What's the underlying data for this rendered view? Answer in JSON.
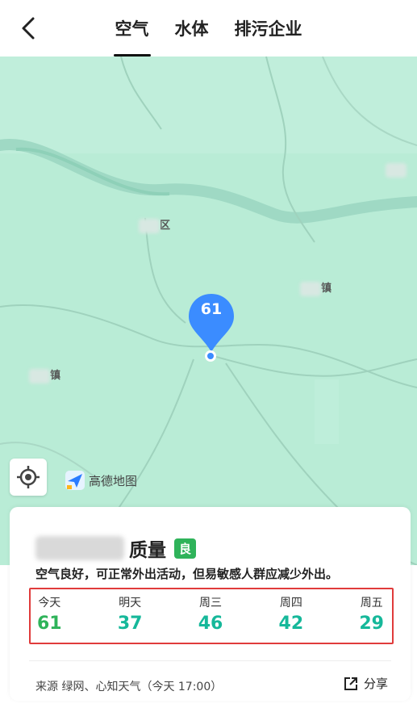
{
  "header": {
    "tabs": [
      {
        "label": "空气",
        "active": true
      },
      {
        "label": "水体",
        "active": false
      },
      {
        "label": "排污企业",
        "active": false
      }
    ]
  },
  "map": {
    "places": [
      {
        "suffix": "区"
      },
      {
        "suffix": "镇"
      },
      {
        "suffix": "镇"
      }
    ],
    "marker_value": "61",
    "provider_label": "高德地图",
    "colors": {
      "background": "#b9ecd6",
      "river": "#9fd9c4",
      "marker": "#3b8cff"
    }
  },
  "card": {
    "title_suffix": "质量",
    "level": "良",
    "advice": "空气良好，可正常外出活动，但易敏感人群应减少外出。",
    "forecast": [
      {
        "day": "今天",
        "value": "61"
      },
      {
        "day": "明天",
        "value": "37"
      },
      {
        "day": "周三",
        "value": "46"
      },
      {
        "day": "周四",
        "value": "42"
      },
      {
        "day": "周五",
        "value": "29"
      }
    ],
    "source": "来源 绿网、心知天气（今天 17:00）",
    "share_label": "分享",
    "colors": {
      "good": "#2fb35a",
      "value": "#16b89a",
      "highlight_border": "#e03b3b"
    }
  }
}
